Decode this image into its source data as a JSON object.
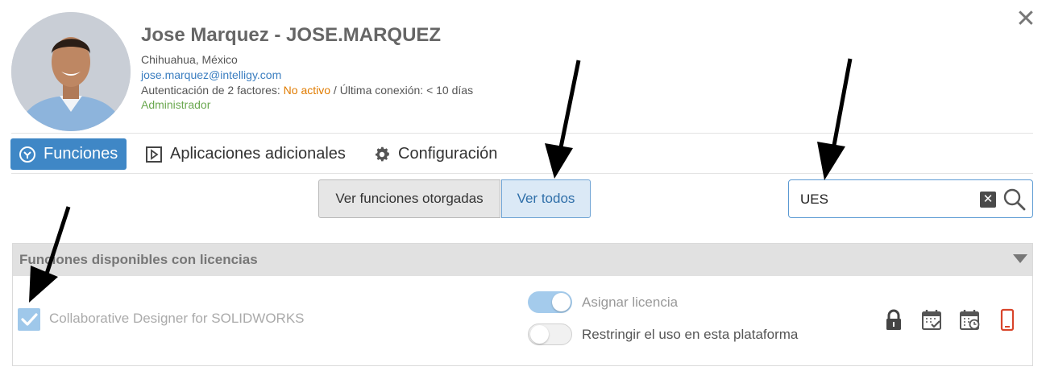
{
  "window": {
    "close_symbol": "✕"
  },
  "user": {
    "name": "Jose Marquez - JOSE.MARQUEZ",
    "location": "Chihuahua, México",
    "email": "jose.marquez@intelligy.com",
    "two_factor_label": "Autenticación de 2 factores: ",
    "two_factor_status": "No activo",
    "last_login": " / Última conexión: < 10 días",
    "role": "Administrador"
  },
  "tabs": [
    {
      "label": "Funciones",
      "icon": "functions-icon",
      "active": true
    },
    {
      "label": "Aplicaciones adicionales",
      "icon": "play-square-icon",
      "active": false
    },
    {
      "label": "Configuración",
      "icon": "gear-icon",
      "active": false
    }
  ],
  "view_toggle": {
    "granted_label": "Ver funciones otorgadas",
    "all_label": "Ver todos",
    "selected": "all"
  },
  "search": {
    "value": "UES",
    "clear_symbol": "✕"
  },
  "section": {
    "title": "Funciones disponibles con licencias",
    "items": [
      {
        "label": "Collaborative Designer for SOLIDWORKS",
        "checked": true,
        "assign_license_label": "Asignar licencia",
        "assign_license_on": true,
        "restrict_label": "Restringir el uso en esta plataforma",
        "restrict_on": false,
        "icons": [
          "lock-icon",
          "calendar-check-icon",
          "calendar-clock-icon",
          "mobile-phone-icon"
        ]
      }
    ]
  },
  "colors": {
    "accent": "#3f87c6",
    "email": "#3b7ec0",
    "warning": "#e07b00",
    "success": "#6aa84f",
    "phone_icon": "#d9452b"
  }
}
